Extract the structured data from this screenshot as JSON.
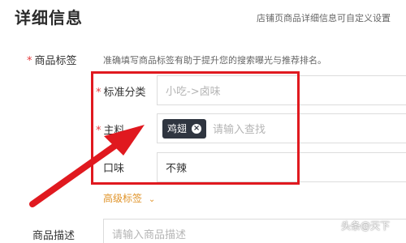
{
  "header": {
    "title": "详细信息",
    "hint": "店铺页商品详细信息可自定义设置"
  },
  "product_tags": {
    "label": "商品标签",
    "required_mark": "*",
    "description": "准确填写商品标签有助于提升您的搜索曝光与推荐排名。",
    "category": {
      "label": "标准分类",
      "required_mark": "*",
      "placeholder": "小吃->卤味"
    },
    "main_ingredient": {
      "label": "主料",
      "required_mark": "*",
      "tags": [
        "鸡翅"
      ],
      "placeholder": "请输入查找"
    },
    "taste": {
      "label": "口味",
      "value": "不辣"
    },
    "advanced": {
      "label": "高级标签",
      "icon": "chevron-down-icon"
    }
  },
  "product_description": {
    "label": "商品描述",
    "placeholder": "请输入商品描述"
  },
  "watermark": "头条@天下",
  "colors": {
    "accent": "#e0942a",
    "required": "#e4393c",
    "annotation": "#e0191f",
    "chip_bg": "#2f3540"
  }
}
